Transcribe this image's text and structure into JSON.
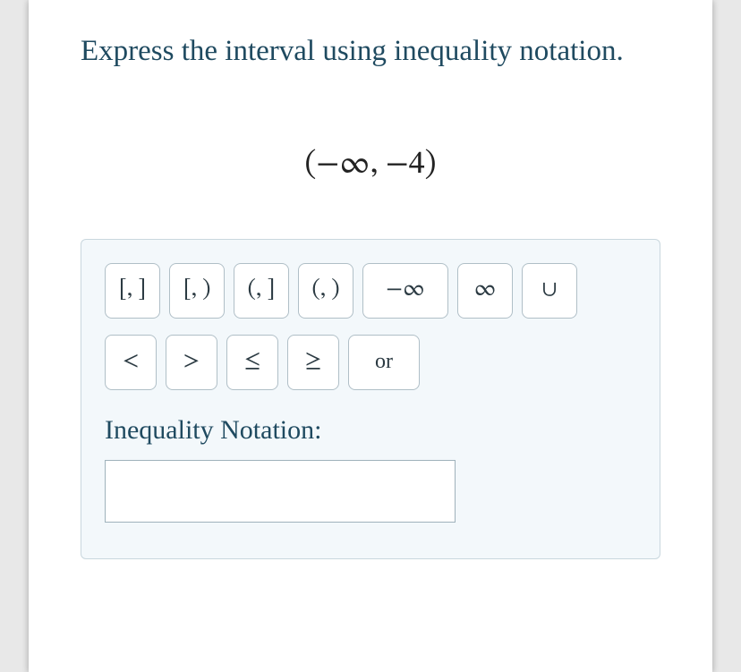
{
  "prompt": "Express the interval using inequality notation.",
  "expression": "(−∞, −4)",
  "palette": {
    "row1": [
      {
        "name": "interval-closed-closed",
        "label": "[, ]"
      },
      {
        "name": "interval-closed-open",
        "label": "[, )"
      },
      {
        "name": "interval-open-closed",
        "label": "(, ]"
      },
      {
        "name": "interval-open-open",
        "label": "(, )"
      },
      {
        "name": "neg-infinity",
        "label": "−∞"
      },
      {
        "name": "pos-infinity",
        "label": "∞"
      },
      {
        "name": "union",
        "label": "∪"
      }
    ],
    "row2": [
      {
        "name": "less-than",
        "label": "<"
      },
      {
        "name": "greater-than",
        "label": ">"
      },
      {
        "name": "less-equal",
        "label": "≤"
      },
      {
        "name": "greater-equal",
        "label": "≥"
      },
      {
        "name": "or",
        "label": "or"
      }
    ]
  },
  "answer_label": "Inequality Notation:",
  "answer_value": ""
}
